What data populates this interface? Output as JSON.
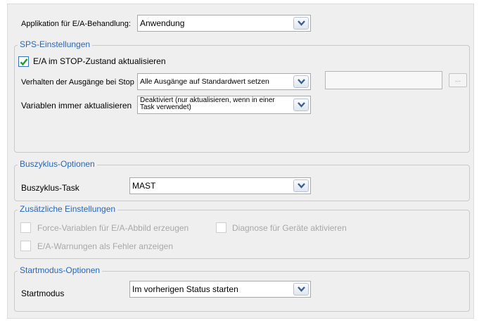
{
  "app_row": {
    "label": "Applikation für E/A-Behandlung:",
    "value": "Anwendung"
  },
  "sps": {
    "title": "SPS-Einstellungen",
    "checkbox_label": "E/A im STOP-Zustand aktualisieren",
    "checkbox_checked": true,
    "outputs_label": "Verhalten der Ausgänge bei Stop",
    "outputs_value": "Alle Ausgänge auf Standardwert setzen",
    "outputs_text_value": "",
    "browse_label": "...",
    "variables_label": "Variablen immer aktualisieren",
    "variables_value": "Deaktiviert (nur aktualisieren, wenn in einer Task verwendet)"
  },
  "bus": {
    "title": "Buszyklus-Optionen",
    "task_label": "Buszyklus-Task",
    "task_value": "MAST"
  },
  "extra": {
    "title": "Zusätzliche Einstellungen",
    "force_label": "Force-Variablen für E/A-Abbild erzeugen",
    "diag_label": "Diagnose für Geräte aktivieren",
    "warn_label": "E/A-Warnungen als Fehler anzeigen"
  },
  "start": {
    "title": "Startmodus-Optionen",
    "mode_label": "Startmodus",
    "mode_value": "Im vorherigen Status starten"
  },
  "colors": {
    "legend": "#2767b8",
    "check": "#1f9a2c",
    "panel": "#efefef"
  }
}
